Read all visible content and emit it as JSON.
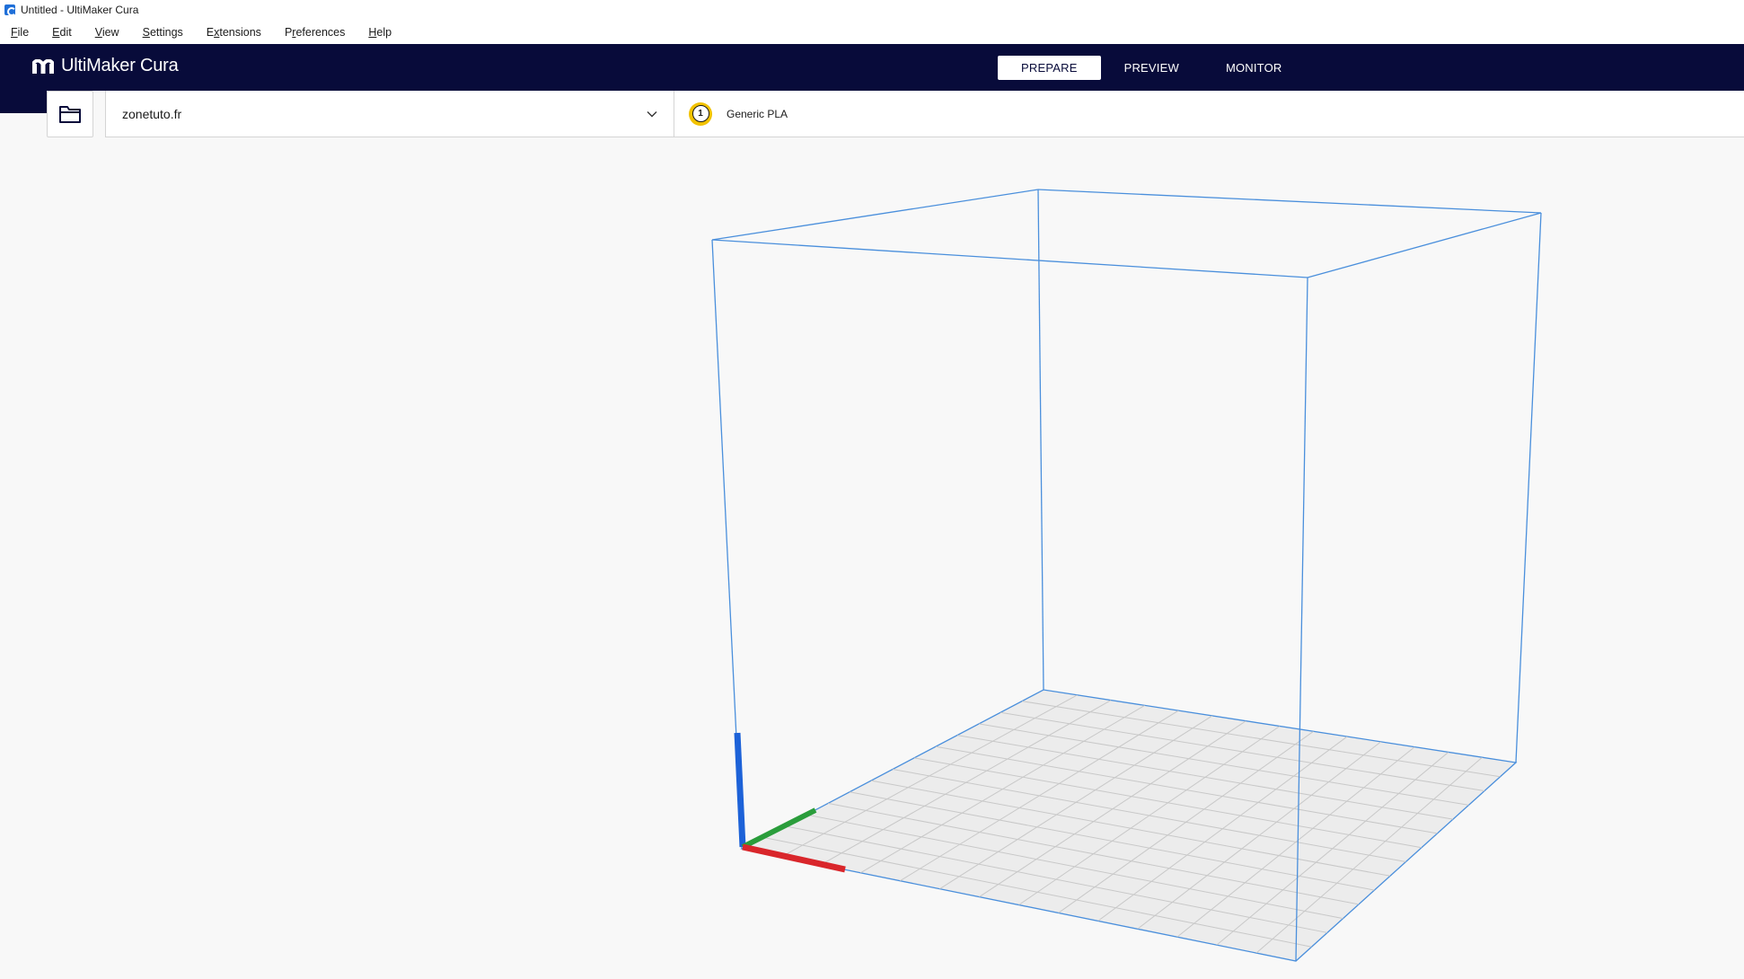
{
  "window": {
    "title": "Untitled - UltiMaker Cura"
  },
  "menu": [
    {
      "pre": "",
      "u": "F",
      "post": "ile"
    },
    {
      "pre": "",
      "u": "E",
      "post": "dit"
    },
    {
      "pre": "",
      "u": "V",
      "post": "iew"
    },
    {
      "pre": "",
      "u": "S",
      "post": "ettings"
    },
    {
      "pre": "E",
      "u": "x",
      "post": "tensions"
    },
    {
      "pre": "P",
      "u": "r",
      "post": "eferences"
    },
    {
      "pre": "",
      "u": "H",
      "post": "elp"
    }
  ],
  "header": {
    "brand": "UltiMaker Cura",
    "tabs": [
      {
        "label": "PREPARE",
        "active": true
      },
      {
        "label": "PREVIEW",
        "active": false
      },
      {
        "label": "MONITOR",
        "active": false
      }
    ]
  },
  "toolbar": {
    "printer_name": "zonetuto.fr",
    "extruder_number": "1",
    "material_name": "Generic PLA"
  },
  "icons": {
    "open": "folder-icon",
    "dropdown": "chevron-down-icon",
    "app": "cura-app-icon",
    "logo": "ultimaker-logo-icon"
  },
  "colors": {
    "header_bg": "#080b3a",
    "volume_edge": "#4a8fdc",
    "axis_x": "#d9262b",
    "axis_y": "#2a9d3b",
    "axis_z": "#1d62d8",
    "extruder_badge": "#f2c200"
  }
}
